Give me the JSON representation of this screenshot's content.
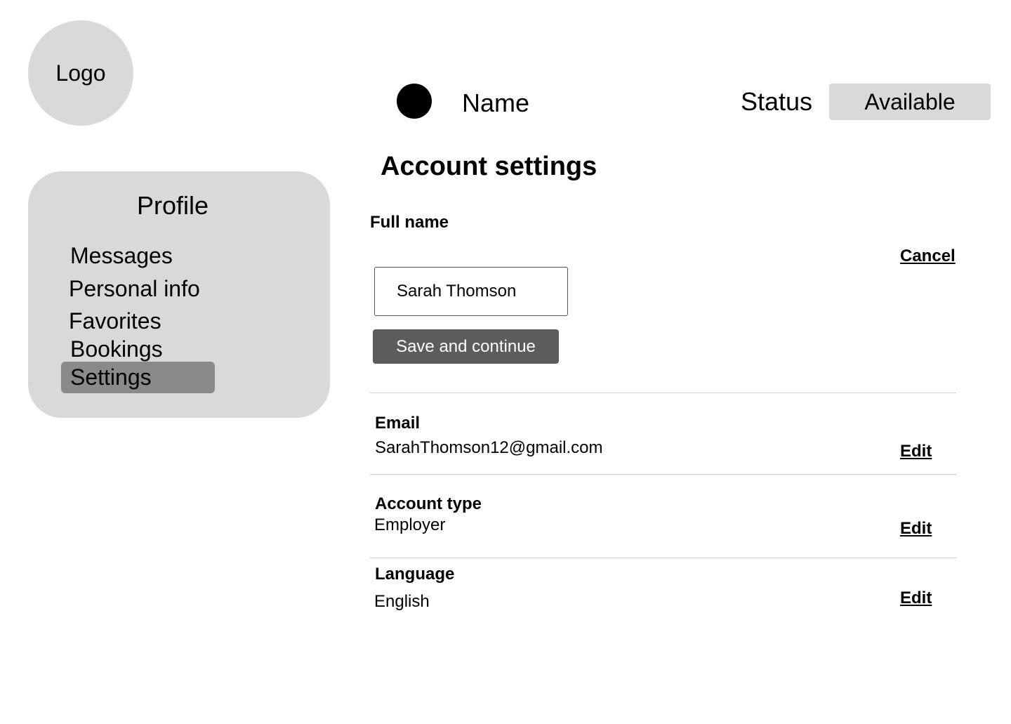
{
  "logo": {
    "label": "Logo"
  },
  "sidebar": {
    "title": "Profile",
    "items": [
      {
        "label": "Messages"
      },
      {
        "label": "Personal info"
      },
      {
        "label": "Favorites"
      },
      {
        "label": "Bookings"
      },
      {
        "label": "Settings",
        "active": true
      }
    ]
  },
  "header": {
    "name": "Name",
    "status_label": "Status",
    "status_value": "Available"
  },
  "main": {
    "title": "Account settings",
    "full_name": {
      "label": "Full name",
      "value": "Sarah Thomson",
      "cancel_label": "Cancel",
      "save_label": "Save and continue"
    },
    "email": {
      "label": "Email",
      "value": "SarahThomson12@gmail.com",
      "edit_label": "Edit"
    },
    "account_type": {
      "label": "Account type",
      "value": "Employer",
      "edit_label": "Edit"
    },
    "language": {
      "label": "Language",
      "value": "English",
      "edit_label": "Edit"
    }
  },
  "colors": {
    "panel_gray": "#d9d9d9",
    "active_gray": "#8a8a8a",
    "button_gray": "#5c5c5c",
    "divider": "#cfcfcf"
  }
}
